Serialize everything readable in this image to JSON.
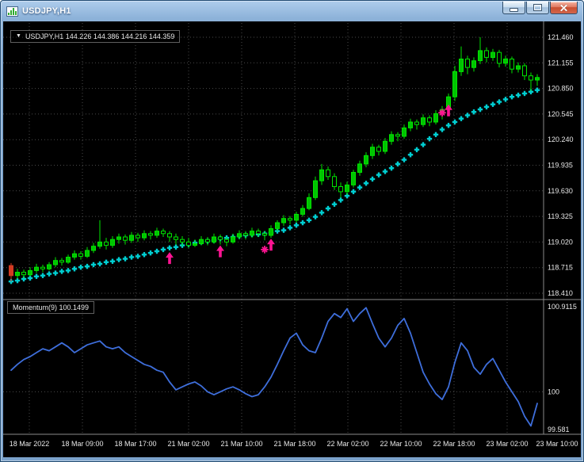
{
  "window": {
    "title": "USDJPY,H1"
  },
  "chart": {
    "dropdown_arrow": "▼",
    "ohlc_label": "USDJPY,H1 144.226 144.386 144.216 144.359",
    "momentum_label": "Momentum(9) 100.1499"
  },
  "chart_data": {
    "type": "candlestick",
    "symbol": "USDJPY",
    "timeframe": "H1",
    "ohlc_display": {
      "open": "144.226",
      "high": "144.386",
      "low": "144.216",
      "close": "144.359"
    },
    "indicators": [
      {
        "name": "Momentum",
        "period": 9,
        "value": "100.1499",
        "position": "subwindow"
      },
      {
        "name": "trail-dots",
        "position": "main"
      }
    ],
    "price_axis_labels": [
      "121.460",
      "121.155",
      "120.850",
      "120.545",
      "120.240",
      "119.935",
      "119.630",
      "119.325",
      "119.020",
      "118.715",
      "118.410"
    ],
    "momentum_axis_labels": [
      "100.9115",
      "100",
      "99.581"
    ],
    "time_labels": [
      "18 Mar 2022",
      "18 Mar 09:00",
      "18 Mar 17:00",
      "21 Mar 02:00",
      "21 Mar 10:00",
      "21 Mar 18:00",
      "22 Mar 02:00",
      "22 Mar 10:00",
      "22 Mar 18:00",
      "23 Mar 02:00",
      "23 Mar 10:00"
    ],
    "price_range": {
      "min": 118.41,
      "max": 121.46
    },
    "momentum_range": {
      "min": 99.581,
      "max": 100.9115
    },
    "grid": true,
    "candles": [
      [
        118.74,
        118.77,
        118.55,
        118.62
      ],
      [
        118.62,
        118.7,
        118.58,
        118.66
      ],
      [
        118.66,
        118.69,
        118.59,
        118.63
      ],
      [
        118.63,
        118.72,
        118.61,
        118.68
      ],
      [
        118.68,
        118.76,
        118.65,
        118.72
      ],
      [
        118.72,
        118.75,
        118.66,
        118.7
      ],
      [
        118.7,
        118.78,
        118.68,
        118.75
      ],
      [
        118.75,
        118.84,
        118.72,
        118.8
      ],
      [
        118.8,
        118.83,
        118.74,
        118.78
      ],
      [
        118.78,
        118.87,
        118.76,
        118.84
      ],
      [
        118.84,
        118.92,
        118.81,
        118.88
      ],
      [
        118.88,
        118.91,
        118.81,
        118.85
      ],
      [
        118.85,
        118.96,
        118.83,
        118.92
      ],
      [
        118.92,
        119.01,
        118.89,
        118.97
      ],
      [
        118.97,
        119.28,
        118.94,
        119.02
      ],
      [
        119.02,
        119.07,
        118.93,
        118.98
      ],
      [
        118.98,
        119.09,
        118.95,
        119.05
      ],
      [
        119.05,
        119.12,
        119.0,
        119.08
      ],
      [
        119.08,
        119.11,
        118.99,
        119.04
      ],
      [
        119.04,
        119.14,
        119.01,
        119.1
      ],
      [
        119.1,
        119.13,
        119.02,
        119.07
      ],
      [
        119.07,
        119.16,
        119.04,
        119.12
      ],
      [
        119.12,
        119.15,
        119.05,
        119.1
      ],
      [
        119.1,
        119.19,
        119.07,
        119.15
      ],
      [
        119.15,
        119.18,
        119.08,
        119.12
      ],
      [
        119.12,
        119.15,
        119.02,
        119.08
      ],
      [
        119.08,
        119.12,
        118.99,
        119.05
      ],
      [
        119.05,
        119.09,
        118.97,
        119.02
      ],
      [
        119.02,
        119.07,
        118.95,
        118.98
      ],
      [
        118.98,
        119.05,
        118.96,
        119.0
      ],
      [
        119.0,
        119.09,
        118.98,
        119.05
      ],
      [
        119.05,
        119.08,
        118.98,
        119.02
      ],
      [
        119.02,
        119.12,
        119.0,
        119.08
      ],
      [
        119.08,
        119.11,
        118.99,
        119.05
      ],
      [
        119.05,
        119.08,
        118.97,
        119.02
      ],
      [
        119.02,
        119.12,
        119.0,
        119.08
      ],
      [
        119.08,
        119.16,
        119.05,
        119.12
      ],
      [
        119.12,
        119.15,
        119.05,
        119.1
      ],
      [
        119.1,
        119.19,
        119.07,
        119.15
      ],
      [
        119.15,
        119.18,
        119.08,
        119.12
      ],
      [
        119.12,
        119.15,
        119.04,
        119.1
      ],
      [
        119.1,
        119.22,
        119.07,
        119.18
      ],
      [
        119.18,
        119.28,
        119.15,
        119.25
      ],
      [
        119.25,
        119.34,
        119.21,
        119.3
      ],
      [
        119.3,
        119.33,
        119.23,
        119.28
      ],
      [
        119.28,
        119.38,
        119.25,
        119.35
      ],
      [
        119.35,
        119.46,
        119.32,
        119.42
      ],
      [
        119.42,
        119.6,
        119.4,
        119.55
      ],
      [
        119.55,
        119.8,
        119.52,
        119.75
      ],
      [
        119.75,
        119.95,
        119.7,
        119.88
      ],
      [
        119.88,
        119.92,
        119.76,
        119.8
      ],
      [
        119.8,
        119.84,
        119.64,
        119.68
      ],
      [
        119.68,
        119.73,
        119.55,
        119.62
      ],
      [
        119.62,
        119.74,
        119.58,
        119.7
      ],
      [
        119.7,
        119.88,
        119.67,
        119.85
      ],
      [
        119.85,
        119.99,
        119.81,
        119.95
      ],
      [
        119.95,
        120.09,
        119.91,
        120.05
      ],
      [
        120.05,
        120.19,
        120.01,
        120.15
      ],
      [
        120.15,
        120.18,
        120.05,
        120.1
      ],
      [
        120.1,
        120.26,
        120.07,
        120.22
      ],
      [
        120.22,
        120.34,
        120.18,
        120.3
      ],
      [
        120.3,
        120.33,
        120.22,
        120.28
      ],
      [
        120.28,
        120.42,
        120.25,
        120.38
      ],
      [
        120.38,
        120.49,
        120.34,
        120.45
      ],
      [
        120.45,
        120.48,
        120.36,
        120.42
      ],
      [
        120.42,
        120.54,
        120.39,
        120.5
      ],
      [
        120.5,
        120.53,
        120.4,
        120.45
      ],
      [
        120.45,
        120.59,
        120.42,
        120.55
      ],
      [
        120.55,
        120.64,
        120.48,
        120.6
      ],
      [
        120.6,
        120.79,
        120.55,
        120.75
      ],
      [
        120.75,
        121.12,
        120.7,
        121.05
      ],
      [
        121.05,
        121.35,
        121.0,
        121.2
      ],
      [
        121.2,
        121.24,
        121.02,
        121.1
      ],
      [
        121.1,
        121.22,
        121.05,
        121.18
      ],
      [
        121.18,
        121.46,
        121.14,
        121.3
      ],
      [
        121.3,
        121.34,
        121.16,
        121.22
      ],
      [
        121.22,
        121.32,
        121.18,
        121.28
      ],
      [
        121.28,
        121.31,
        121.1,
        121.15
      ],
      [
        121.15,
        121.24,
        121.11,
        121.2
      ],
      [
        121.2,
        121.23,
        121.03,
        121.08
      ],
      [
        121.08,
        121.16,
        121.04,
        121.12
      ],
      [
        121.12,
        121.15,
        120.95,
        121.0
      ],
      [
        121.0,
        121.04,
        120.82,
        120.95
      ],
      [
        120.95,
        121.02,
        120.88,
        120.98
      ]
    ],
    "trail": [
      118.55,
      118.56,
      118.58,
      118.59,
      118.61,
      118.62,
      118.64,
      118.65,
      118.67,
      118.68,
      118.7,
      118.72,
      118.73,
      118.75,
      118.76,
      118.78,
      118.79,
      118.81,
      118.82,
      118.84,
      118.85,
      118.87,
      118.89,
      118.91,
      118.93,
      118.95,
      118.96,
      118.98,
      118.99,
      119.01,
      119.02,
      119.03,
      119.04,
      119.06,
      119.07,
      119.08,
      119.09,
      119.1,
      119.11,
      119.11,
      119.12,
      119.13,
      119.15,
      119.16,
      119.19,
      119.22,
      119.25,
      119.28,
      119.32,
      119.37,
      119.42,
      119.47,
      119.52,
      119.57,
      119.62,
      119.67,
      119.72,
      119.77,
      119.82,
      119.86,
      119.9,
      119.95,
      120.0,
      120.06,
      120.12,
      120.18,
      120.25,
      120.3,
      120.36,
      120.41,
      120.45,
      120.49,
      120.53,
      120.57,
      120.6,
      120.63,
      120.66,
      120.69,
      120.72,
      120.75,
      120.77,
      120.79,
      120.81,
      120.83
    ],
    "momentum": [
      100.22,
      100.28,
      100.33,
      100.36,
      100.4,
      100.44,
      100.42,
      100.46,
      100.5,
      100.46,
      100.4,
      100.44,
      100.48,
      100.5,
      100.52,
      100.46,
      100.44,
      100.46,
      100.4,
      100.36,
      100.32,
      100.28,
      100.26,
      100.22,
      100.2,
      100.1,
      100.02,
      100.05,
      100.08,
      100.1,
      100.06,
      100.0,
      99.97,
      100.0,
      100.03,
      100.05,
      100.02,
      99.98,
      99.95,
      99.97,
      100.05,
      100.15,
      100.28,
      100.42,
      100.55,
      100.6,
      100.48,
      100.42,
      100.4,
      100.55,
      100.72,
      100.8,
      100.76,
      100.85,
      100.72,
      100.8,
      100.86,
      100.7,
      100.55,
      100.46,
      100.55,
      100.68,
      100.75,
      100.6,
      100.4,
      100.2,
      100.08,
      99.98,
      99.92,
      100.05,
      100.3,
      100.5,
      100.42,
      100.25,
      100.18,
      100.28,
      100.34,
      100.22,
      100.1,
      100.0,
      99.9,
      99.75,
      99.65,
      99.88
    ],
    "signals": {
      "arrows": [
        {
          "bar": 25,
          "price": 118.9
        },
        {
          "bar": 33,
          "price": 118.98
        },
        {
          "bar": 41,
          "price": 119.06
        },
        {
          "bar": 69,
          "price": 120.66
        }
      ],
      "stars": [
        {
          "bar": 40,
          "price": 118.93
        },
        {
          "bar": 68,
          "price": 120.56
        }
      ]
    },
    "colors": {
      "background": "#000000",
      "grid": "#4a4a4a",
      "text": "#e8e8e8",
      "candle_outline": "#00e600",
      "bull": "#00c400",
      "bear_fill": "#000000",
      "first_bar": "#d23b22",
      "trail": "#00ced1",
      "signal": "#ff1493",
      "momentum_line": "#3e6edb",
      "separator": "#8a8a8a"
    }
  }
}
